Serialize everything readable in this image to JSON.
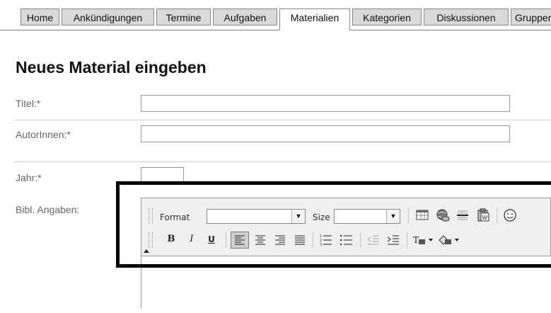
{
  "tabs": [
    {
      "label": "Home"
    },
    {
      "label": "Ankündigungen"
    },
    {
      "label": "Termine"
    },
    {
      "label": "Aufgaben"
    },
    {
      "label": "Materialien",
      "active": true
    },
    {
      "label": "Kategorien"
    },
    {
      "label": "Diskussionen"
    },
    {
      "label": "Gruppen"
    }
  ],
  "page": {
    "title": "Neues Material eingeben"
  },
  "form": {
    "titel_label": "Titel:*",
    "autoren_label": "AutorInnen:*",
    "jahr_label": "Jahr:*",
    "bibl_label": "Bibl. Angaben:"
  },
  "editor": {
    "format_label": "Format",
    "format_value": "",
    "size_label": "Size",
    "size_value": "",
    "bold_glyph": "B",
    "italic_glyph": "I",
    "underline_glyph": "U"
  }
}
